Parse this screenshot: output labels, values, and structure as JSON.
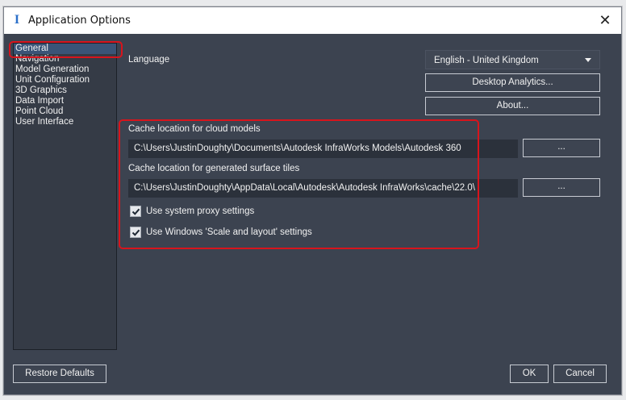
{
  "window": {
    "title": "Application Options",
    "close_glyph": "✕",
    "icon_letter": "I"
  },
  "nav": {
    "items": [
      {
        "label": "General"
      },
      {
        "label": "Navigation"
      },
      {
        "label": "Model Generation"
      },
      {
        "label": "Unit Configuration"
      },
      {
        "label": "3D Graphics"
      },
      {
        "label": "Data Import"
      },
      {
        "label": "Point Cloud"
      },
      {
        "label": "User Interface"
      }
    ],
    "selected": "General"
  },
  "general": {
    "language_label": "Language",
    "language_value": "English - United Kingdom",
    "desktop_analytics_button": "Desktop Analytics...",
    "about_button": "About...",
    "cloud_cache_label": "Cache location for cloud models",
    "cloud_cache_path": "C:\\Users\\JustinDoughty\\Documents\\Autodesk InfraWorks Models\\Autodesk 360",
    "browse_label": "...",
    "tiles_cache_label": "Cache location for generated surface tiles",
    "tiles_cache_path": "C:\\Users\\JustinDoughty\\AppData\\Local\\Autodesk\\Autodesk InfraWorks\\cache\\22.0\\",
    "proxy_label": "Use system proxy settings",
    "proxy_checked": true,
    "scale_label": "Use Windows 'Scale and layout' settings",
    "scale_checked": true
  },
  "footer": {
    "restore_defaults": "Restore Defaults",
    "ok": "OK",
    "cancel": "Cancel"
  },
  "colors": {
    "highlight_box": "#d8141c",
    "panel_bg": "#3c4350"
  }
}
